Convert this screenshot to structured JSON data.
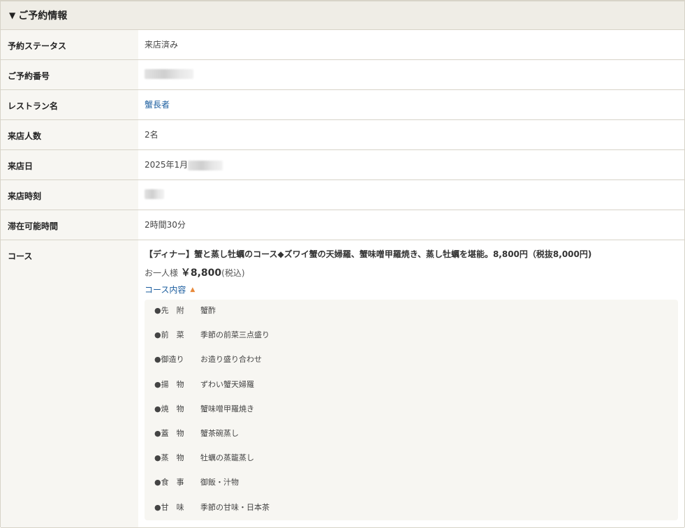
{
  "section": {
    "title": "ご予約情報",
    "toggle_glyph": "▼"
  },
  "rows": {
    "status": {
      "label": "予約ステータス",
      "value": "来店済み"
    },
    "reservation_number": {
      "label": "ご予約番号"
    },
    "restaurant": {
      "label": "レストラン名",
      "value": "蟹長者"
    },
    "party_size": {
      "label": "来店人数",
      "value": "2名"
    },
    "visit_date": {
      "label": "来店日",
      "value_prefix": "2025年1月"
    },
    "visit_time": {
      "label": "来店時刻"
    },
    "stay_duration": {
      "label": "滞在可能時間",
      "value": "2時間30分"
    },
    "course": {
      "label": "コース",
      "title": "【ディナー】蟹と蒸し牡蠣のコース◆ズワイ蟹の天婦羅、蟹味噌甲羅焼き、蒸し牡蠣を堪能。8,800円（税抜8,000円)",
      "price_prefix": "お一人様",
      "price_amount": "￥8,800",
      "price_suffix": "(税込)",
      "toggle_label": "コース内容",
      "toggle_glyph": "▲",
      "items": [
        {
          "category": "●先　附",
          "dish": "蟹酢"
        },
        {
          "category": "●前　菜",
          "dish": "季節の前菜三点盛り"
        },
        {
          "category": "●御造り",
          "dish": "お造り盛り合わせ"
        },
        {
          "category": "●揚　物",
          "dish": "ずわい蟹天婦羅"
        },
        {
          "category": "●焼　物",
          "dish": "蟹味噌甲羅焼き"
        },
        {
          "category": "●蓋　物",
          "dish": "蟹茶碗蒸し"
        },
        {
          "category": "●蒸　物",
          "dish": "牡蠣の蒸籠蒸し"
        },
        {
          "category": "●食　事",
          "dish": "御飯・汁物"
        },
        {
          "category": "●甘　味",
          "dish": "季節の甘味・日本茶"
        }
      ]
    }
  },
  "colors": {
    "header_bg": "#efede6",
    "label_bg": "#f7f6f2",
    "border": "#d7d3c8",
    "link": "#1a5c9e",
    "caret": "#e8893a"
  }
}
